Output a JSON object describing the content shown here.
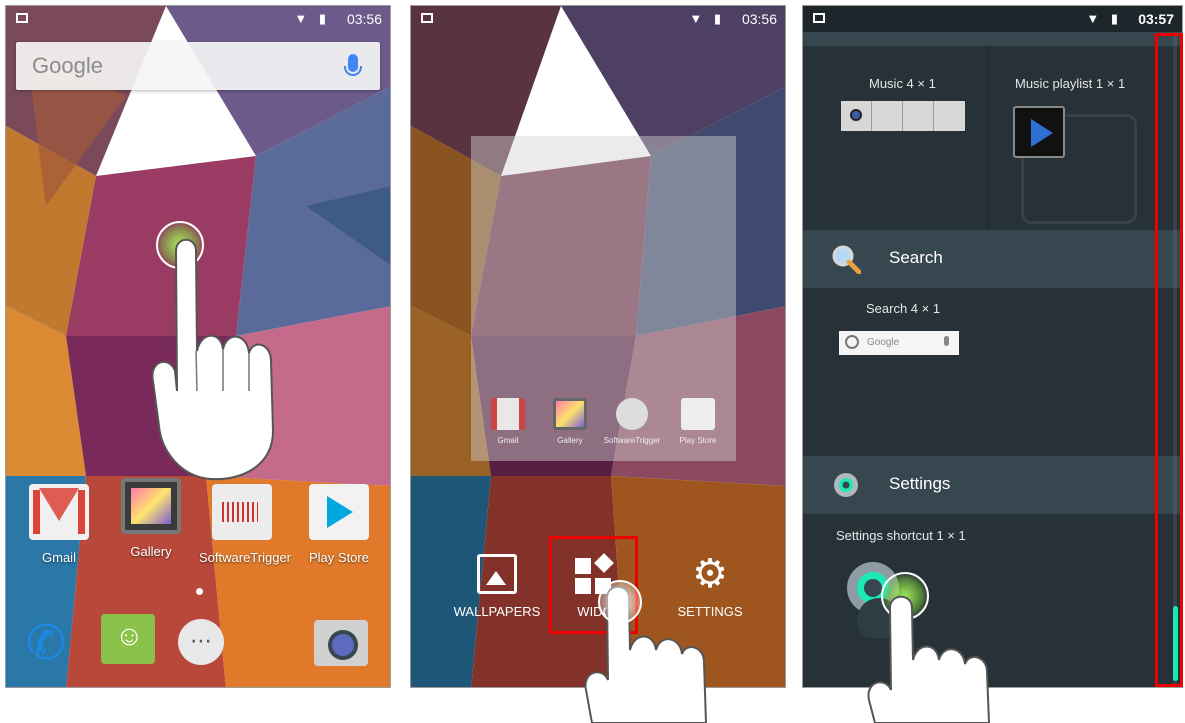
{
  "panel1": {
    "status_time": "03:56",
    "search_bar_label": "Google",
    "apps": [
      {
        "label": "Gmail",
        "icon": "gmail-icon"
      },
      {
        "label": "Gallery",
        "icon": "gallery-icon"
      },
      {
        "label": "SoftwareTrigger",
        "icon": "software-trigger-icon"
      },
      {
        "label": "Play Store",
        "icon": "play-store-icon"
      }
    ],
    "dock": [
      "phone-icon",
      "messaging-icon",
      "app-drawer-icon",
      "camera-icon"
    ]
  },
  "panel2": {
    "status_time": "03:56",
    "preview_apps": [
      {
        "label": "Gmail"
      },
      {
        "label": "Gallery"
      },
      {
        "label": "SoftwareTrigger"
      },
      {
        "label": "Play Store"
      }
    ],
    "menu": {
      "wallpapers_label": "WALLPAPERS",
      "widgets_label": "WIDG",
      "settings_label": "SETTINGS"
    }
  },
  "panel3": {
    "status_time": "03:57",
    "music_widget_label": "Music  4 × 1",
    "music_playlist_label": "Music playlist  1 × 1",
    "search_section_title": "Search",
    "search_widget_label": "Search  4 × 1",
    "search_widget_logo": "Google",
    "settings_section_title": "Settings",
    "settings_shortcut_label": "Settings shortcut  1 × 1"
  },
  "colors": {
    "highlight": "#e00000",
    "scroll_thumb": "#1de9b6",
    "widget_bg": "#263238"
  }
}
